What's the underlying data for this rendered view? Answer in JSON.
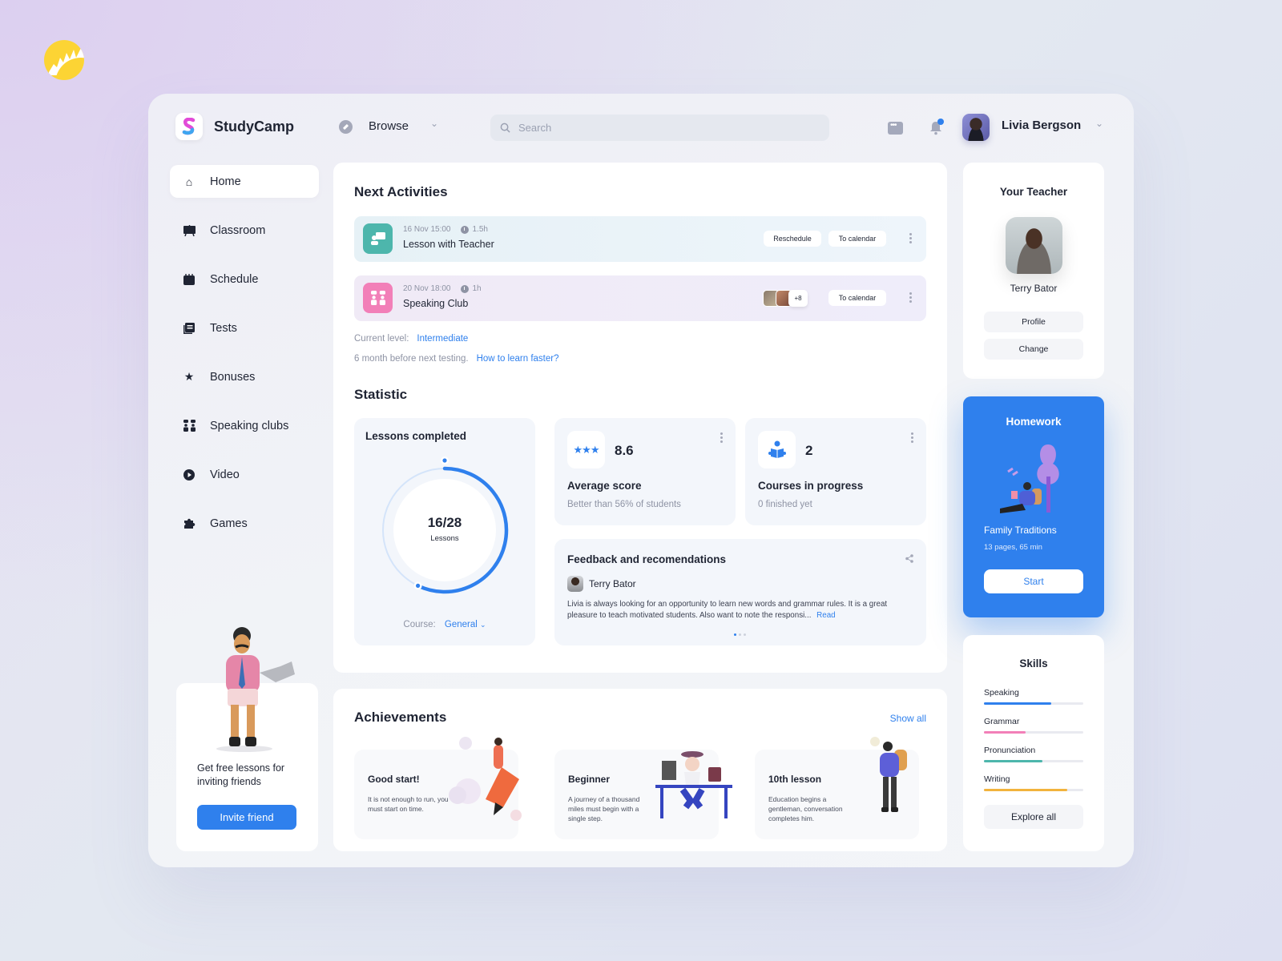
{
  "brand_icon": "sun-logo-icon",
  "header": {
    "app_name": "StudyCamp",
    "browse_label": "Browse",
    "search_placeholder": "Search",
    "user_name": "Livia Bergson",
    "notification_dot_color": "#2f80ed"
  },
  "sidebar": {
    "items": [
      {
        "label": "Home",
        "icon": "home-icon",
        "active": true
      },
      {
        "label": "Classroom",
        "icon": "classroom-board-icon"
      },
      {
        "label": "Schedule",
        "icon": "calendar-icon"
      },
      {
        "label": "Tests",
        "icon": "tests-book-icon"
      },
      {
        "label": "Bonuses",
        "icon": "star-icon"
      },
      {
        "label": "Speaking clubs",
        "icon": "speaking-clubs-icon"
      },
      {
        "label": "Video",
        "icon": "play-circle-icon"
      },
      {
        "label": "Games",
        "icon": "puzzle-icon"
      }
    ],
    "invite": {
      "text": "Get free lessons for inviting friends",
      "button": "Invite friend"
    }
  },
  "next_activities": {
    "title": "Next Activities",
    "items": [
      {
        "date": "16 Nov 15:00",
        "duration": "1.5h",
        "title": "Lesson with Teacher",
        "actions": [
          "Reschedule",
          "To calendar"
        ]
      },
      {
        "date": "20 Nov 18:00",
        "duration": "1h",
        "title": "Speaking Club",
        "participants_extra": "+8",
        "actions": [
          "To calendar"
        ]
      }
    ],
    "level_label": "Current level:",
    "level_value": "Intermediate",
    "testing_text": "6 month before next testing.",
    "testing_link": "How to learn faster?"
  },
  "statistic": {
    "title": "Statistic",
    "lessons": {
      "title": "Lessons completed",
      "value": "16/28",
      "unit": "Lessons",
      "completed": 16,
      "total": 28,
      "course_label": "Course:",
      "course_value": "General"
    },
    "average_score": {
      "value": "8.6",
      "title": "Average score",
      "sub": "Better than 56% of students"
    },
    "courses": {
      "value": "2",
      "title": "Courses in progress",
      "sub": "0 finished yet"
    },
    "feedback": {
      "title": "Feedback and recomendations",
      "author": "Terry Bator",
      "text": "Livia is always looking for an opportunity to learn new words and grammar rules. It is a great pleasure to teach motivated students. Also want to note the responsi...",
      "read_link": "Read",
      "page": 1,
      "pages": 3
    }
  },
  "achievements": {
    "title": "Achievements",
    "show_all": "Show all",
    "items": [
      {
        "title": "Good start!",
        "text": "It is not enough to run, you must start on time."
      },
      {
        "title": "Beginner",
        "text": "A journey of a thousand miles must begin with a single step."
      },
      {
        "title": "10th lesson",
        "text": "Education begins a gentleman, conversation completes him."
      }
    ]
  },
  "teacher": {
    "title": "Your Teacher",
    "name": "Terry Bator",
    "profile_btn": "Profile",
    "change_btn": "Change"
  },
  "homework": {
    "title": "Homework",
    "name": "Family Traditions",
    "meta": "13 pages, 65 min",
    "button": "Start",
    "color": "#2f80ed"
  },
  "skills": {
    "title": "Skills",
    "items": [
      {
        "name": "Speaking",
        "percent": 68,
        "color": "#2f80ed"
      },
      {
        "name": "Grammar",
        "percent": 42,
        "color": "#f27fb8"
      },
      {
        "name": "Pronunciation",
        "percent": 59,
        "color": "#4db6ac"
      },
      {
        "name": "Writing",
        "percent": 84,
        "color": "#f2b33d"
      }
    ],
    "button": "Explore all"
  }
}
